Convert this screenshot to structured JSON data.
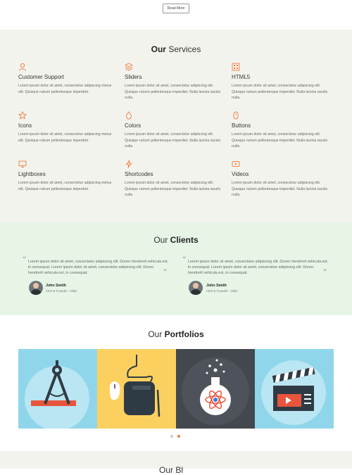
{
  "top": {
    "read_more": "Read More"
  },
  "services": {
    "title_bold": "Our",
    "title_rest": " Services",
    "items": [
      {
        "icon": "user-icon",
        "name": "Customer Support",
        "desc": "Lorem ipsum dolor sit amet, consectetur adipiscing metus elit. Quisque rutrum pellentesque imperdiet."
      },
      {
        "icon": "layers-icon",
        "name": "Sliders",
        "desc": "Lorem ipsum dolor sit amet, consectetur adipiscing elit. Quisque rutrum pellentesque imperdiet. Nulla lacinia iaculis nulla."
      },
      {
        "icon": "grid-icon",
        "name": "HTML5",
        "desc": "Lorem ipsum dolor sit amet, consectetur adipiscing elit. Quisque rutrum pellentesque imperdiet. Nulla lacinia iaculis nulla."
      },
      {
        "icon": "star-icon",
        "name": "Icons",
        "desc": "Lorem ipsum dolor sit amet, consectetur adipiscing metus elit. Quisque rutrum pellentesque imperdiet."
      },
      {
        "icon": "drop-icon",
        "name": "Colors",
        "desc": "Lorem ipsum dolor sit amet, consectetur adipiscing elit. Quisque rutrum pellentesque imperdiet. Nulla lacinia iaculis nulla."
      },
      {
        "icon": "mouse-icon",
        "name": "Buttons",
        "desc": "Lorem ipsum dolor sit amet, consectetur adipiscing elit. Quisque rutrum pellentesque imperdiet. Nulla lacinia iaculis nulla."
      },
      {
        "icon": "monitor-icon",
        "name": "Lightboxes",
        "desc": "Lorem ipsum dolor sit amet, consectetur adipiscing metus elit. Quisque rutrum pellentesque imperdiet."
      },
      {
        "icon": "bolt-icon",
        "name": "Shortcodes",
        "desc": "Lorem ipsum dolor sit amet, consectetur adipiscing elit. Quisque rutrum pellentesque imperdiet. Nulla lacinia iaculis nulla."
      },
      {
        "icon": "play-icon",
        "name": "Videos",
        "desc": "Lorem ipsum dolor sit amet, consectetur adipiscing elit. Quisque rutrum pellentesque imperdiet. Nulla lacinia iaculis nulla."
      }
    ]
  },
  "clients": {
    "title_light": "Our ",
    "title_bold": "Clients",
    "testimonials": [
      {
        "quote": "Lorem ipsum dolor sit amet, consectetur adipiscing elit. Donec hendrerit vehicula est, in consequat. Lorem ipsum dolor sit amet, consectetur adipiscing elit. Donec hendrerit vehicula est, in consequat.",
        "name": "John Smith",
        "role": "CEO & Founder - Okler"
      },
      {
        "quote": "Lorem ipsum dolor sit amet, consectetur adipiscing elit. Donec hendrerit vehicula est, in consequat. Lorem ipsum dolor sit amet, consectetur adipiscing elit. Donec hendrerit vehicula est, in consequat.",
        "name": "John Smith",
        "role": "CEO & Founder - Okler"
      }
    ]
  },
  "portfolios": {
    "title_light": "Our ",
    "title_bold": "Portfolios",
    "tiles": [
      {
        "icon": "compass-icon",
        "bg": "#8fd6ea"
      },
      {
        "icon": "tablet-icon",
        "bg": "#fbd05f"
      },
      {
        "icon": "flask-icon",
        "bg": "#43474e"
      },
      {
        "icon": "clapper-icon",
        "bg": "#8fd6ea"
      }
    ],
    "dots": {
      "inactive": "#cccccc",
      "active": "#f07c3c"
    }
  },
  "bottom": {
    "title": "Our Bl"
  },
  "colors": {
    "accent": "#f07c3c"
  }
}
